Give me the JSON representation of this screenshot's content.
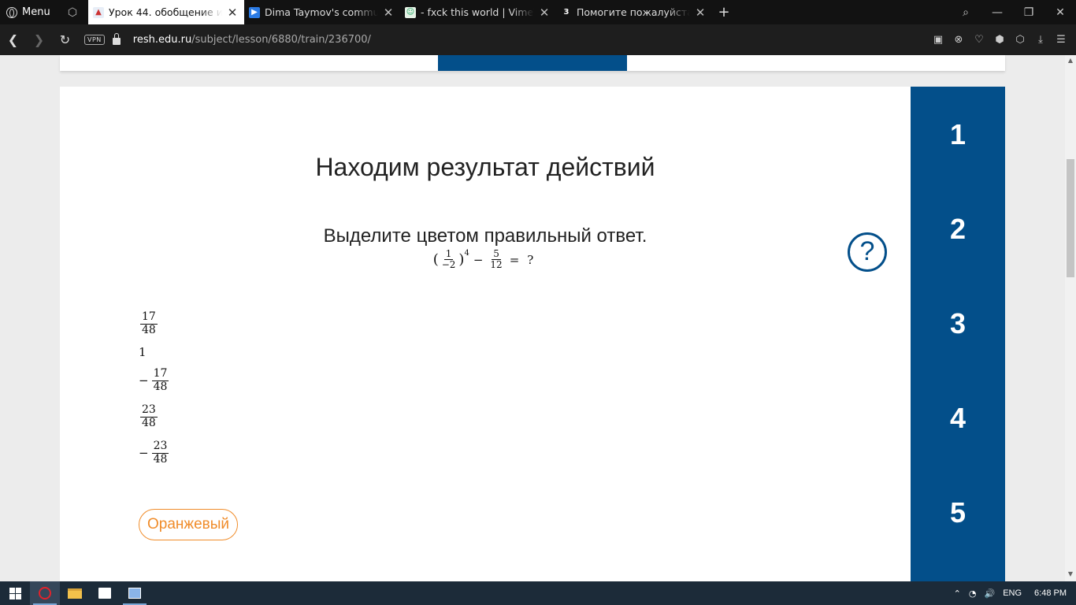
{
  "browser": {
    "menu_label": "Menu",
    "tabs": [
      {
        "title": "Урок 44. обобщение и сис",
        "active": true
      },
      {
        "title": "Dima Taymov's communitie",
        "active": false
      },
      {
        "title": "- fxck this world | VimeTop",
        "active": false
      },
      {
        "title": "Помогите пожалуйста, не",
        "active": false,
        "badge": "3"
      }
    ],
    "new_tab": "+",
    "url_host": "resh.edu.ru",
    "url_path": "/subject/lesson/6880/train/236700/",
    "vpn_label": "VPN"
  },
  "lesson": {
    "title": "Находим результат действий",
    "instruction": "Выделите цветом правильный ответ.",
    "help_symbol": "?",
    "equation": {
      "paren_open": "(",
      "frac1_num": "1",
      "frac1_den": "−2",
      "paren_close": ")",
      "exponent": "4",
      "minus": "−",
      "frac2_num": "5",
      "frac2_den": "12",
      "equals": "=",
      "question": "?"
    },
    "answers": [
      {
        "sign": "",
        "num": "17",
        "den": "48"
      },
      {
        "plain": "1"
      },
      {
        "sign": "−",
        "num": "17",
        "den": "48"
      },
      {
        "sign": "",
        "num": "23",
        "den": "48"
      },
      {
        "sign": "−",
        "num": "23",
        "den": "48"
      }
    ],
    "color_button": "Оранжевый",
    "steps": [
      "1",
      "2",
      "3",
      "4",
      "5"
    ]
  },
  "taskbar": {
    "lang": "ENG",
    "time": "6:48 PM"
  },
  "colors": {
    "accent_blue": "#034f8a",
    "orange": "#f08c2a"
  }
}
